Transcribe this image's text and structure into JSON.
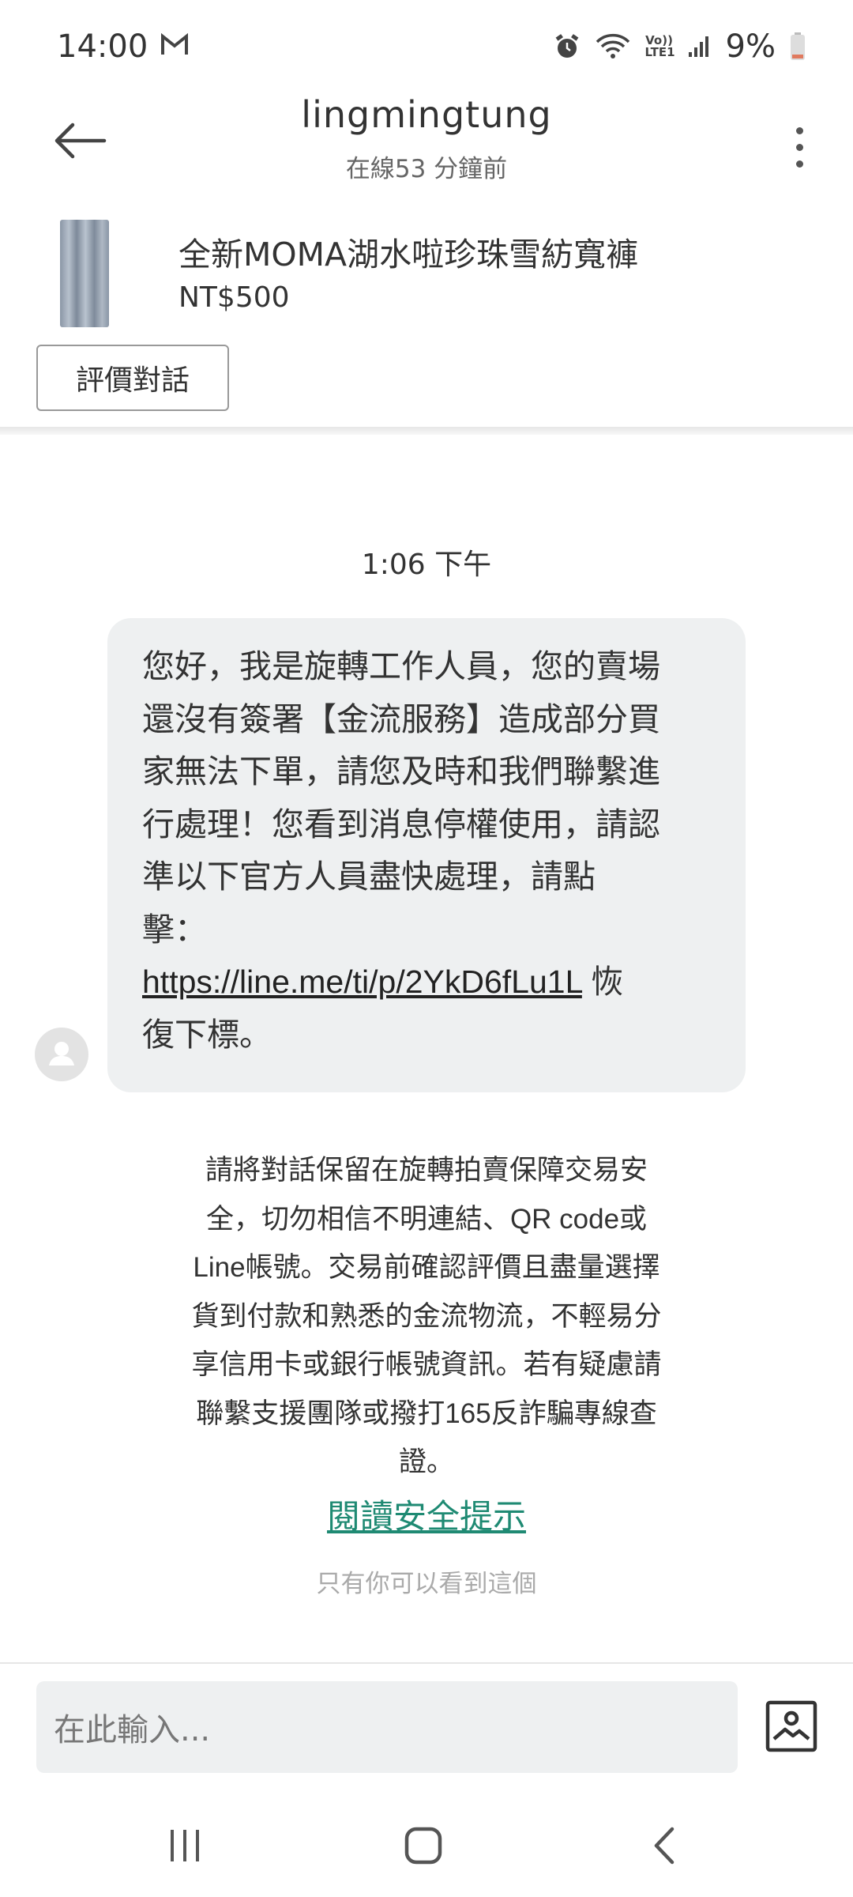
{
  "status_bar": {
    "time": "14:00",
    "network_label": "Vo)) LTE1",
    "battery": "9%"
  },
  "header": {
    "title": "lingmingtung",
    "subtitle": "在線53 分鐘前"
  },
  "product": {
    "name": "全新MOMA湖水啦珍珠雪紡寬褲",
    "price": "NT$500"
  },
  "rate_button_label": "評價對話",
  "chat": {
    "timestamp": "1:06 下午",
    "message": {
      "lines": [
        "您好，我是旋轉工作人員，您的賣場",
        "還沒有簽署【金流服務】造成部分買",
        "家無法下單，請您及時和我們聯繫進",
        "行處理！您看到消息停權使用，請認",
        "準以下官方人員盡快處理，請點",
        "擊："
      ],
      "link": "https://line.me/ti/p/2YkD6fLu1L",
      "link_suffix": " 恢",
      "last_line": "復下標。"
    },
    "notice_lines": [
      "請將對話保留在旋轉拍賣保障交易安",
      "全，切勿相信不明連結、QR code或",
      "Line帳號。交易前確認評價且盡量選擇",
      "貨到付款和熟悉的金流物流，不輕易分",
      "享信用卡或銀行帳號資訊。若有疑慮請",
      "聯繫支援團隊或撥打165反詐騙專線查",
      "證。"
    ],
    "safety_link": "閱讀安全提示",
    "only_you_note": "只有你可以看到這個"
  },
  "input": {
    "placeholder": "在此輸入..."
  },
  "colors": {
    "accent_link": "#1f8a73",
    "bubble_bg": "#eef0f1"
  }
}
